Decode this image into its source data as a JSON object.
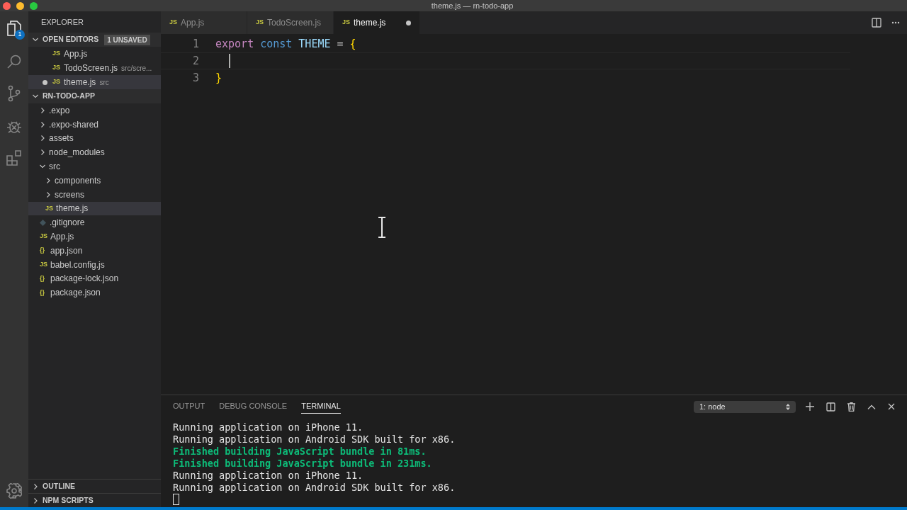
{
  "window": {
    "title": "theme.js — rn-todo-app"
  },
  "activity_bar": {
    "badge": "1"
  },
  "sidebar": {
    "title": "EXPLORER",
    "open_editors": {
      "label": "OPEN EDITORS",
      "badge": "1 UNSAVED",
      "expanded": true,
      "items": [
        {
          "icon": "JS",
          "name": "App.js",
          "dirty": false,
          "selected": false
        },
        {
          "icon": "JS",
          "name": "TodoScreen.js",
          "path": "src/scre...",
          "dirty": false,
          "selected": false
        },
        {
          "icon": "JS",
          "name": "theme.js",
          "path": "src",
          "dirty": true,
          "selected": true
        }
      ]
    },
    "project": {
      "label": "RN-TODO-APP",
      "expanded": true,
      "children": [
        {
          "kind": "folder",
          "name": ".expo",
          "expanded": false,
          "selected": false
        },
        {
          "kind": "folder",
          "name": ".expo-shared",
          "expanded": false,
          "selected": false
        },
        {
          "kind": "folder",
          "name": "assets",
          "expanded": false,
          "selected": false
        },
        {
          "kind": "folder",
          "name": "node_modules",
          "expanded": false,
          "selected": false
        },
        {
          "kind": "folder",
          "name": "src",
          "expanded": true,
          "selected": false,
          "children": [
            {
              "kind": "folder",
              "name": "components",
              "expanded": false,
              "selected": false
            },
            {
              "kind": "folder",
              "name": "screens",
              "expanded": false,
              "selected": false
            },
            {
              "kind": "file",
              "icon": "JS",
              "name": "theme.js",
              "selected": true
            }
          ]
        },
        {
          "kind": "git",
          "name": ".gitignore",
          "selected": false
        },
        {
          "kind": "file",
          "icon": "JS",
          "name": "App.js",
          "selected": false
        },
        {
          "kind": "file",
          "icon": "{}",
          "name": "app.json",
          "selected": false
        },
        {
          "kind": "file",
          "icon": "JS",
          "name": "babel.config.js",
          "selected": false
        },
        {
          "kind": "file",
          "icon": "{}",
          "name": "package-lock.json",
          "selected": false
        },
        {
          "kind": "file",
          "icon": "{}",
          "name": "package.json",
          "selected": false
        }
      ]
    },
    "bottom_sections": [
      {
        "label": "OUTLINE",
        "expanded": false
      },
      {
        "label": "NPM SCRIPTS",
        "expanded": false
      }
    ]
  },
  "tabs": [
    {
      "icon": "JS",
      "label": "App.js",
      "selected": false,
      "dirty": false
    },
    {
      "icon": "JS",
      "label": "TodoScreen.js",
      "selected": false,
      "dirty": false
    },
    {
      "icon": "JS",
      "label": "theme.js",
      "selected": true,
      "dirty": true
    }
  ],
  "editor": {
    "lines": [
      {
        "number": "1",
        "current": false,
        "tokens": [
          {
            "kind": "keyword",
            "text": "export"
          },
          {
            "kind": "storage",
            "text": "const"
          },
          {
            "kind": "variable",
            "text": "THEME"
          },
          {
            "kind": "plain",
            "text": "="
          },
          {
            "kind": "brace",
            "text": "{"
          }
        ]
      },
      {
        "number": "2",
        "current": true
      },
      {
        "number": "3",
        "current": false,
        "tokens": [
          {
            "kind": "brace",
            "text": "}"
          }
        ]
      }
    ]
  },
  "panel": {
    "tabs": [
      {
        "label": "OUTPUT",
        "selected": false
      },
      {
        "label": "DEBUG CONSOLE",
        "selected": false
      },
      {
        "label": "TERMINAL",
        "selected": true
      }
    ],
    "terminal_select": {
      "value": "1: node"
    },
    "terminal_lines": [
      {
        "kind": "output",
        "text": "Running application on iPhone 11."
      },
      {
        "kind": "output",
        "text": "Running application on Android SDK built for x86."
      },
      {
        "kind": "success",
        "text": "Finished building JavaScript bundle in 81ms."
      },
      {
        "kind": "success",
        "text": "Finished building JavaScript bundle in 231ms."
      },
      {
        "kind": "output",
        "text": "Running application on iPhone 11."
      },
      {
        "kind": "output",
        "text": "Running application on Android SDK built for x86."
      }
    ]
  }
}
